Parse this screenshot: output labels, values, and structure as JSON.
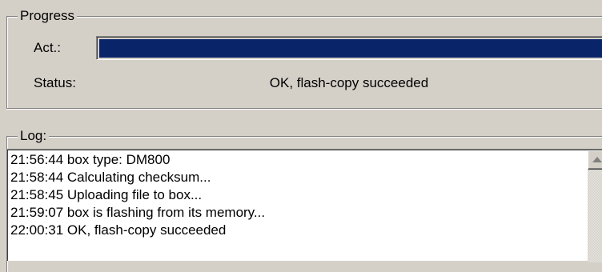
{
  "progress": {
    "group_label": "Progress",
    "act_label": "Act.:",
    "act_fraction": 1.0,
    "status_label": "Status:",
    "status_value": "OK, flash-copy succeeded",
    "bar_color": "#0a246a"
  },
  "log": {
    "group_label": "Log:",
    "lines": [
      "21:56:44 box type: DM800",
      "21:58:44 Calculating checksum...",
      "21:58:45 Uploading file to box...",
      "21:59:07 box is flashing from its memory...",
      "22:00:31 OK, flash-copy succeeded"
    ]
  },
  "scrollbar": {
    "up_icon": "arrow-up-icon"
  }
}
